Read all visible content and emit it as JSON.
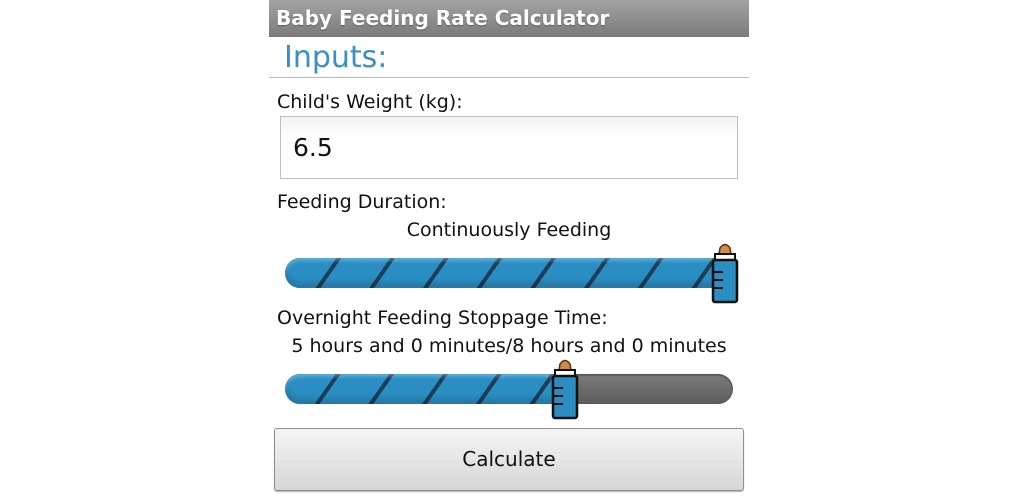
{
  "app": {
    "title": "Baby Feeding Rate Calculator"
  },
  "inputs_section": {
    "title": "Inputs:"
  },
  "weight": {
    "label": "Child's Weight (kg):",
    "value": "6.5"
  },
  "feeding_duration": {
    "label": "Feeding Duration:",
    "value_text": "Continuously Feeding",
    "level": 1.0
  },
  "overnight_stoppage": {
    "label": "Overnight Feeding Stoppage Time:",
    "value_text": "5 hours and 0 minutes/8 hours and 0 minutes",
    "level": 0.625
  },
  "calculate_button": {
    "label": "Calculate"
  },
  "colors": {
    "title_accent": "#3a8fc6",
    "slider_fill": "#2a8ec3",
    "bottle_cap": "#d08a4a"
  },
  "icons": {
    "slider_thumb": "baby-bottle-icon"
  }
}
